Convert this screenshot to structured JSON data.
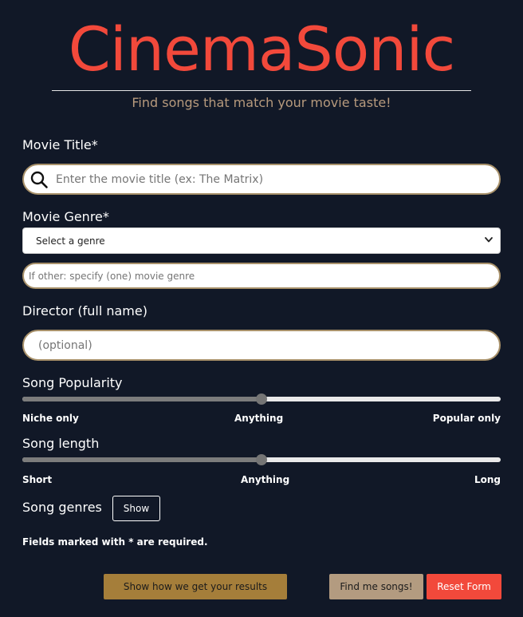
{
  "header": {
    "app_title": "CinemaSonic",
    "tagline": "Find songs that match your movie taste!"
  },
  "form": {
    "movie_title": {
      "label": "Movie Title*",
      "placeholder": "Enter the movie title (ex: The Matrix)",
      "icon": "search-icon"
    },
    "movie_genre": {
      "label": "Movie Genre*",
      "selected": "Select a genre",
      "other_placeholder": "If other: specify (one) movie genre"
    },
    "director": {
      "label": "Director (full name)",
      "placeholder": "(optional)"
    },
    "song_popularity": {
      "label": "Song Popularity",
      "value": 0.5,
      "min_label": "Niche only",
      "mid_label": "Anything",
      "max_label": "Popular only"
    },
    "song_length": {
      "label": "Song length",
      "value": 0.5,
      "min_label": "Short",
      "mid_label": "Anything",
      "max_label": "Long"
    },
    "song_genres": {
      "label": "Song genres",
      "button": "Show"
    },
    "required_note": "Fields marked with * are required."
  },
  "actions": {
    "how_label": "Show how we get your results",
    "find_label": "Find me songs!",
    "reset_label": "Reset Form"
  },
  "colors": {
    "background": "#111827",
    "brand": "#f2493b",
    "tagline": "#b79a7d",
    "input_border": "#a8916a",
    "how_button": "#a57e3a",
    "find_button": "#b39b80",
    "reset_button": "#f2493b"
  }
}
